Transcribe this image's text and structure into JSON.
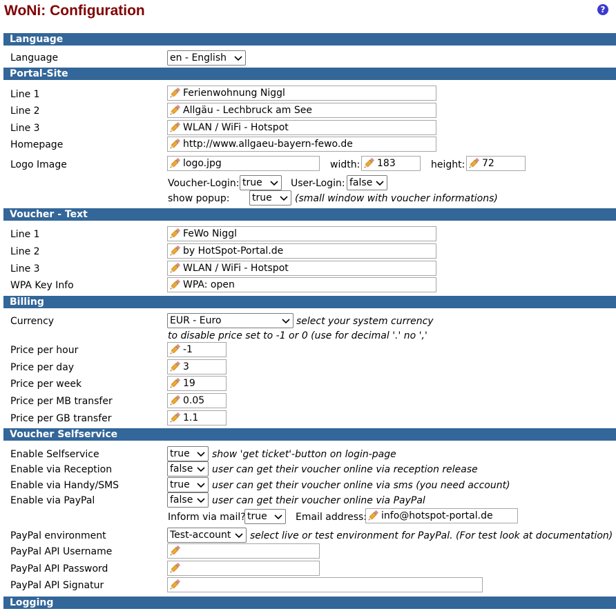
{
  "header": {
    "title": "WoNi: Configuration",
    "help_glyph": "?"
  },
  "sections": {
    "language": "Language",
    "portal": "Portal-Site",
    "voucher_text": "Voucher - Text",
    "billing": "Billing",
    "selfservice": "Voucher Selfservice",
    "logging": "Logging"
  },
  "language": {
    "label": "Language",
    "value": "en - English"
  },
  "portal": {
    "line1_label": "Line 1",
    "line1": "Ferienwohnung Niggl",
    "line2_label": "Line 2",
    "line2": "Allgäu - Lechbruck am See",
    "line3_label": "Line 3",
    "line3": "WLAN / WiFi - Hotspot",
    "homepage_label": "Homepage",
    "homepage": "http://www.allgaeu-bayern-fewo.de",
    "logo_label": "Logo Image",
    "logo": "logo.jpg",
    "width_label": "width:",
    "width": "183",
    "height_label": "height:",
    "height": "72",
    "voucher_login_label": "Voucher-Login:",
    "voucher_login": "true",
    "user_login_label": "User-Login:",
    "user_login": "false",
    "popup_label": "show popup:",
    "popup": "true",
    "popup_note": "(small window with voucher informations)"
  },
  "voucher_text": {
    "line1_label": "Line 1",
    "line1": "FeWo Niggl",
    "line2_label": "Line 2",
    "line2": "by HotSpot-Portal.de",
    "line3_label": "Line 3",
    "line3": "WLAN / WiFi - Hotspot",
    "wpa_label": "WPA Key Info",
    "wpa": "WPA: open"
  },
  "billing": {
    "currency_label": "Currency",
    "currency": "EUR - Euro",
    "currency_note": "select your system currency",
    "disable_note": "to disable price set to -1 or 0 (use for decimal '.' no ',' ",
    "hour_label": "Price per hour",
    "hour": "-1",
    "day_label": "Price per day",
    "day": "3",
    "week_label": "Price per week",
    "week": "19",
    "mb_label": "Price per MB transfer",
    "mb": "0.05",
    "gb_label": "Price per GB transfer",
    "gb": "1.1"
  },
  "selfservice": {
    "enable_label": "Enable Selfservice",
    "enable": "true",
    "enable_note": "show 'get ticket'-button on login-page",
    "reception_label": "Enable via Reception",
    "reception": "false",
    "reception_note": "user can get their voucher online via reception release",
    "sms_label": "Enable via Handy/SMS",
    "sms": "true",
    "sms_note": "user can get their voucher online via sms (you need account)",
    "paypal_label": "Enable via PayPal",
    "paypal": "false",
    "paypal_note": "user can get their voucher online via PayPal",
    "inform_label": "Inform via mail?",
    "inform": "true",
    "email_label": "Email address:",
    "email": "info@hotspot-portal.de",
    "env_label": "PayPal environment",
    "env": "Test-account",
    "env_note": "select live or test environment for PayPal. (For test look at documentation)",
    "api_user_label": "PayPal API Username",
    "api_user": "",
    "api_pass_label": "PayPal API Password",
    "api_pass": "",
    "api_sig_label": "PayPal API Signatur",
    "api_sig": ""
  },
  "icons": {
    "field": "pencil-icon",
    "dropdown": "chevron-down-icon"
  },
  "colors": {
    "section_bar": "#336699",
    "title": "#800000"
  }
}
